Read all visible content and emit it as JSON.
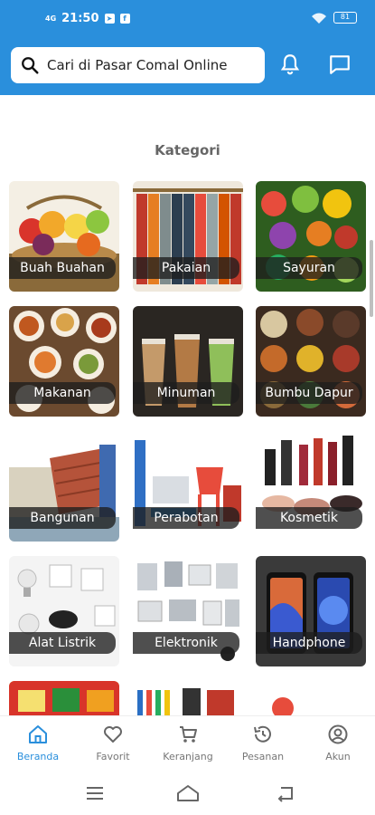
{
  "status_bar": {
    "signal": "4G",
    "time": "21:50",
    "battery": "81"
  },
  "search": {
    "placeholder": "Cari di Pasar Comal Online"
  },
  "section_title": "Kategori",
  "categories": [
    {
      "label": "Buah Buahan"
    },
    {
      "label": "Pakaian"
    },
    {
      "label": "Sayuran"
    },
    {
      "label": "Makanan"
    },
    {
      "label": "Minuman"
    },
    {
      "label": "Bumbu Dapur"
    },
    {
      "label": "Bangunan"
    },
    {
      "label": "Perabotan"
    },
    {
      "label": "Kosmetik"
    },
    {
      "label": "Alat Listrik"
    },
    {
      "label": "Elektronik"
    },
    {
      "label": "Handphone"
    }
  ],
  "bottom_nav": [
    {
      "label": "Beranda",
      "icon": "home-icon",
      "active": true
    },
    {
      "label": "Favorit",
      "icon": "heart-icon"
    },
    {
      "label": "Keranjang",
      "icon": "cart-icon"
    },
    {
      "label": "Pesanan",
      "icon": "history-icon"
    },
    {
      "label": "Akun",
      "icon": "account-icon"
    }
  ],
  "colors": {
    "primary": "#2a8fdc",
    "active": "#2a8fdc",
    "inactive": "#777777"
  }
}
